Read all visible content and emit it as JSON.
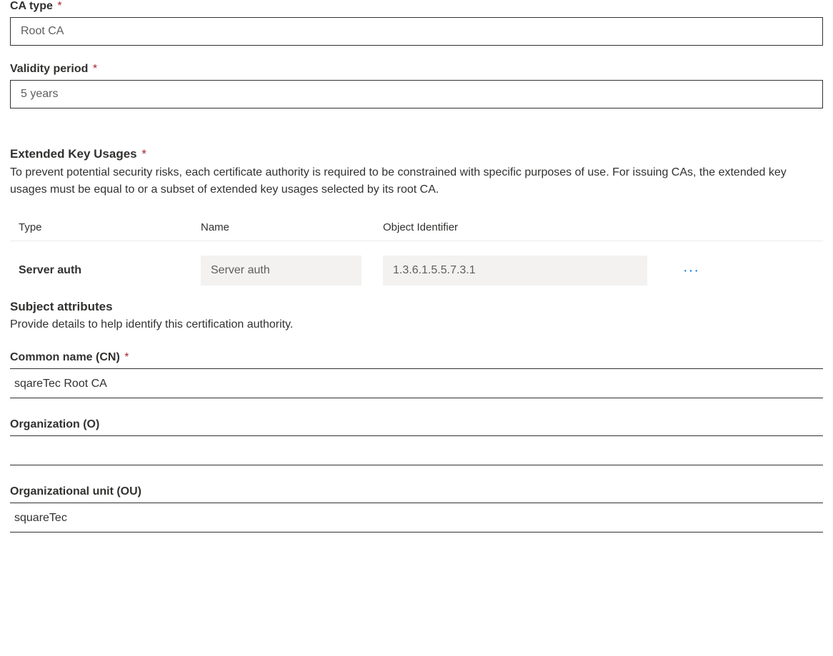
{
  "ca_type": {
    "label": "CA type",
    "value": "Root CA"
  },
  "validity_period": {
    "label": "Validity period",
    "value": "5 years"
  },
  "eku": {
    "heading": "Extended Key Usages",
    "description": "To prevent potential security risks, each certificate authority is required to be constrained with specific purposes of use. For issuing CAs, the extended key usages must be equal to or a subset of extended key usages selected by its root CA.",
    "columns": {
      "type": "Type",
      "name": "Name",
      "oid": "Object Identifier"
    },
    "rows": [
      {
        "type": "Server auth",
        "name": "Server auth",
        "oid": "1.3.6.1.5.5.7.3.1"
      }
    ]
  },
  "subject": {
    "heading": "Subject attributes",
    "description": "Provide details to help identify this certification authority.",
    "common_name": {
      "label": "Common name (CN)",
      "value": "sqareTec Root CA"
    },
    "organization": {
      "label": "Organization (O)",
      "value": ""
    },
    "organizational_unit": {
      "label": "Organizational unit (OU)",
      "value": "squareTec"
    }
  }
}
